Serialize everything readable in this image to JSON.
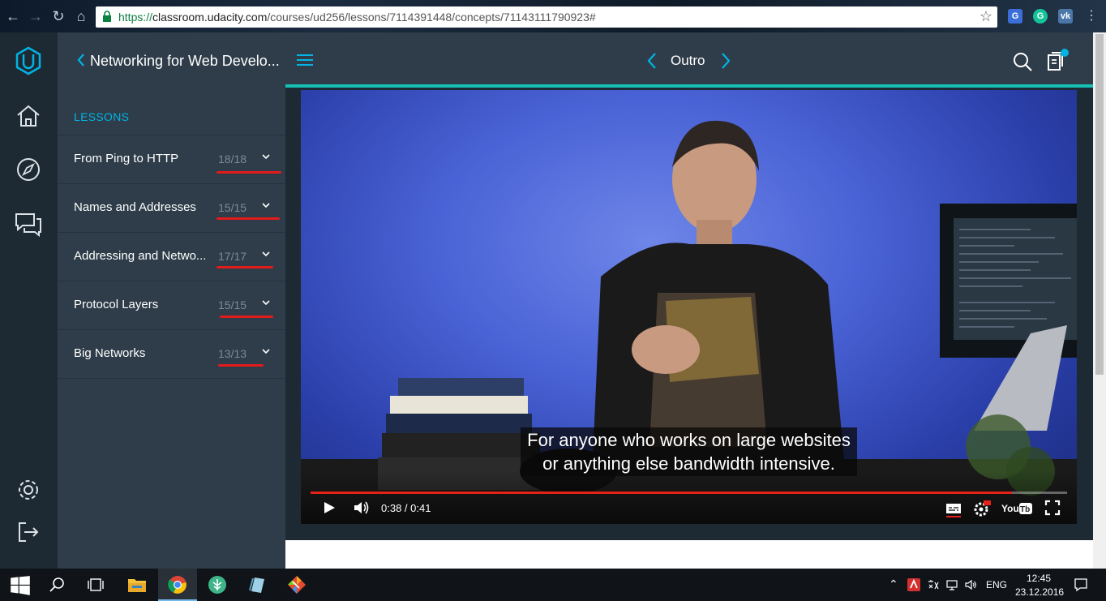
{
  "browser": {
    "url_secure": "https://",
    "url_host": "classroom.udacity.com",
    "url_path": "/courses/ud256/lessons/7114391448/concepts/71143111790923#"
  },
  "sidebar": {
    "course_title": "Networking for Web Develo...",
    "lessons_label": "LESSONS",
    "lessons": [
      {
        "name": "From Ping to HTTP",
        "count": "18/18"
      },
      {
        "name": "Names and Addresses",
        "count": "15/15"
      },
      {
        "name": "Addressing and Netwo...",
        "count": "17/17"
      },
      {
        "name": "Protocol Layers",
        "count": "15/15"
      },
      {
        "name": "Big Networks",
        "count": "13/13"
      }
    ]
  },
  "header": {
    "concept_title": "Outro"
  },
  "video": {
    "caption_line1": "For anyone who works on large websites",
    "caption_line2": "or anything else bandwidth intensive.",
    "time": "0:38 / 0:41",
    "progress": 0.927
  },
  "taskbar": {
    "language": "ENG",
    "clock_time": "12:45",
    "clock_date": "23.12.2016"
  },
  "colors": {
    "accent": "#02b3e4",
    "teal": "#15c0b5",
    "annotation_red": "#e21b1b",
    "yt_red": "#e62117"
  }
}
